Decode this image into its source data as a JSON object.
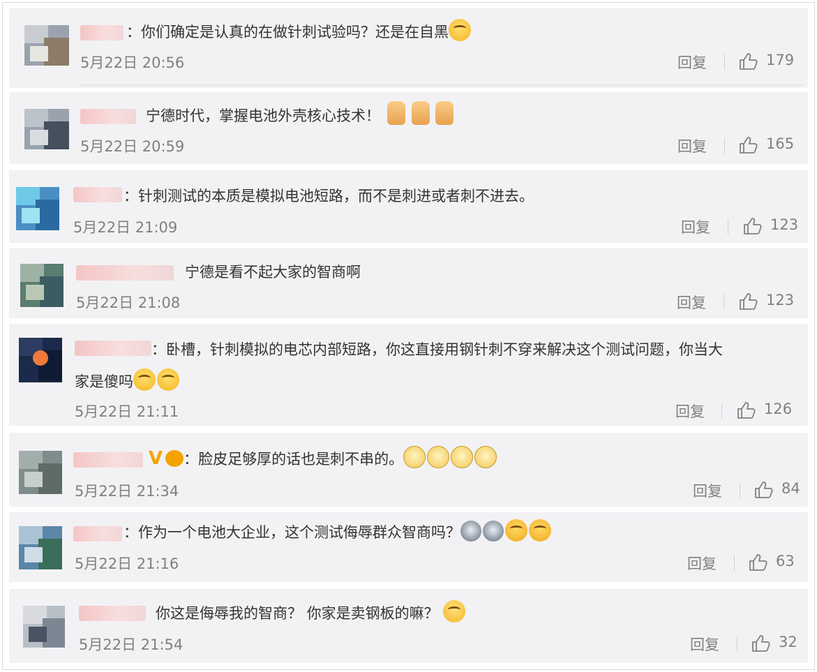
{
  "reply_label": "回复",
  "colors": {
    "background": "#f2f2f5",
    "text": "#333333",
    "meta": "#808080"
  },
  "comments": [
    {
      "text": "：你们确定是认真的在做针刺试验吗？还是在自黑",
      "emoji": [
        "laugh-emoji"
      ],
      "time": "5月22日 20:56",
      "likes": "179"
    },
    {
      "text": "宁德时代，掌握电池外壳核心技术！",
      "emoji": [
        "thumbs-up-emoji",
        "thumbs-up-emoji",
        "thumbs-up-emoji"
      ],
      "time": "5月22日 20:59",
      "likes": "165"
    },
    {
      "text": "：针刺测试的本质是模拟电池短路，而不是刺进或者刺不进去。",
      "emoji": [],
      "time": "5月22日 21:09",
      "likes": "123"
    },
    {
      "text": "宁德是看不起大家的智商啊",
      "emoji": [],
      "time": "5月22日 21:08",
      "likes": "123"
    },
    {
      "text": "：卧槽，针刺模拟的电芯内部短路，你这直接用钢针刺不穿来解决这个测试问题，你当大",
      "text2": "家是傻吗",
      "emoji": [
        "crying-laugh-emoji",
        "crying-laugh-emoji"
      ],
      "time": "5月22日 21:11",
      "likes": "126"
    },
    {
      "text": "：脸皮足够厚的话也是刺不串的。",
      "emoji": [
        "doge-emoji",
        "doge-emoji",
        "doge-emoji",
        "doge-emoji"
      ],
      "time": "5月22日 21:34",
      "likes": "84"
    },
    {
      "text": "：作为一个电池大企业，这个测试侮辱群众智商吗？",
      "emoji": [
        "husky-emoji",
        "husky-emoji",
        "cry-emoji",
        "cry-emoji"
      ],
      "time": "5月22日 21:16",
      "likes": "63"
    },
    {
      "text": "你这是侮辱我的智商？ 你家是卖钢板的嘛？",
      "emoji": [
        "shh-emoji"
      ],
      "time": "5月22日 21:54",
      "likes": "32"
    }
  ]
}
